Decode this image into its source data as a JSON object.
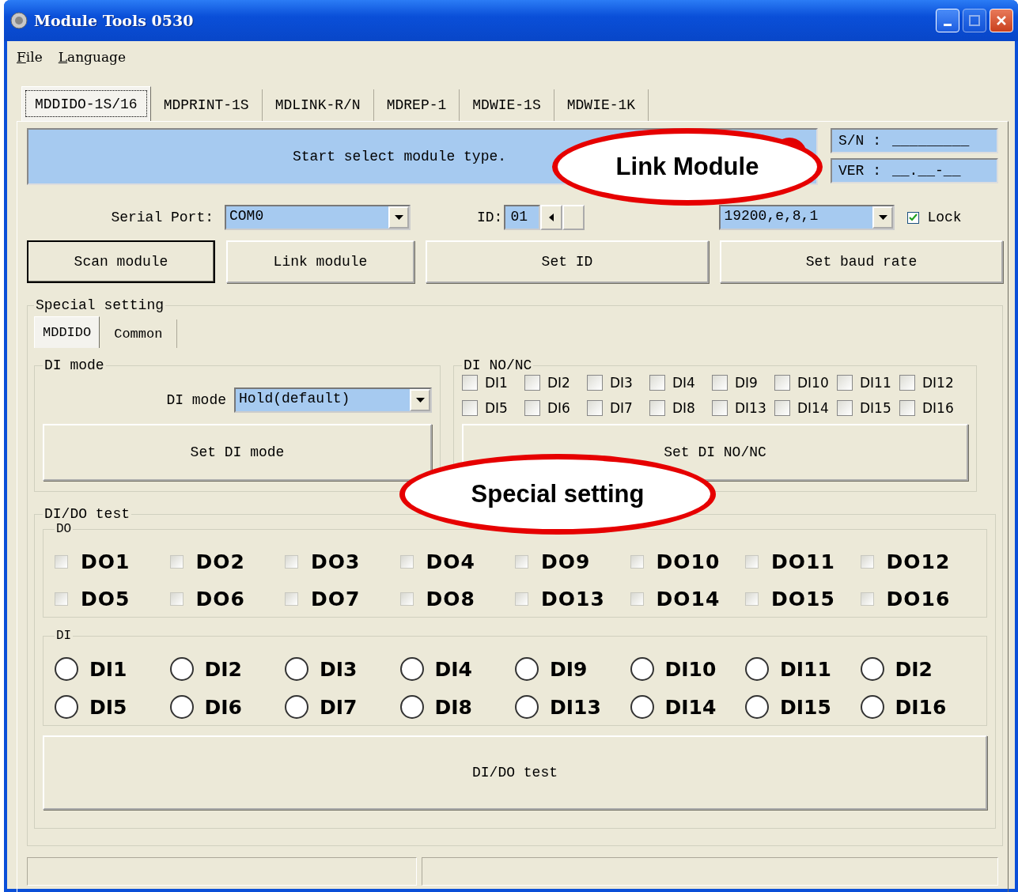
{
  "window": {
    "title": "Module Tools 0530"
  },
  "menu": [
    {
      "label": "File"
    },
    {
      "label": "Language"
    }
  ],
  "tabs": [
    {
      "label": "MDDIDO-1S/16",
      "selected": true
    },
    {
      "label": "MDPRINT-1S",
      "selected": false
    },
    {
      "label": "MDLINK-R/N",
      "selected": false
    },
    {
      "label": "MDREP-1",
      "selected": false
    },
    {
      "label": "MDWIE-1S",
      "selected": false
    },
    {
      "label": "MDWIE-1K",
      "selected": false
    }
  ],
  "status_message": "Start select module type.",
  "info": [
    {
      "label": "S/N :",
      "value": "_________"
    },
    {
      "label": "VER :",
      "value": "__.__-__"
    }
  ],
  "serial_port": {
    "label": "Serial Port:",
    "value": "COM0"
  },
  "id": {
    "label": "ID:",
    "value": "01"
  },
  "baud": {
    "value": "19200,e,8,1"
  },
  "lock": {
    "label": "Lock",
    "checked": true
  },
  "buttons": [
    {
      "label": "Scan module",
      "default": true
    },
    {
      "label": "Link module",
      "default": false
    },
    {
      "label": "Set ID",
      "default": false
    },
    {
      "label": "Set baud rate",
      "default": false
    }
  ],
  "special_setting": {
    "title": "Special setting",
    "tabs": [
      {
        "label": "MDDIDO",
        "selected": true
      },
      {
        "label": "Common",
        "selected": false
      }
    ],
    "di_mode": {
      "title": "DI mode",
      "label": "DI mode",
      "value": "Hold(default)",
      "button": "Set DI mode"
    },
    "di_nonc": {
      "title": "DI NO/NC",
      "items": [
        {
          "label": "DI1",
          "checked": false
        },
        {
          "label": "DI2",
          "checked": false
        },
        {
          "label": "DI3",
          "checked": false
        },
        {
          "label": "DI4",
          "checked": false
        },
        {
          "label": "DI9",
          "checked": false
        },
        {
          "label": "DI10",
          "checked": false
        },
        {
          "label": "DI11",
          "checked": false
        },
        {
          "label": "DI12",
          "checked": false
        },
        {
          "label": "DI5",
          "checked": false
        },
        {
          "label": "DI6",
          "checked": false
        },
        {
          "label": "DI7",
          "checked": false
        },
        {
          "label": "DI8",
          "checked": false
        },
        {
          "label": "DI13",
          "checked": false
        },
        {
          "label": "DI14",
          "checked": false
        },
        {
          "label": "DI15",
          "checked": false
        },
        {
          "label": "DI16",
          "checked": false
        }
      ],
      "button": "Set DI NO/NC"
    },
    "dido_test": {
      "title": "DI/DO test",
      "do": {
        "title": "DO",
        "items": [
          {
            "label": "DO1",
            "checked": false
          },
          {
            "label": "DO2",
            "checked": false
          },
          {
            "label": "DO3",
            "checked": false
          },
          {
            "label": "DO4",
            "checked": false
          },
          {
            "label": "DO9",
            "checked": false
          },
          {
            "label": "DO10",
            "checked": false
          },
          {
            "label": "DO11",
            "checked": false
          },
          {
            "label": "DO12",
            "checked": false
          },
          {
            "label": "DO5",
            "checked": false
          },
          {
            "label": "DO6",
            "checked": false
          },
          {
            "label": "DO7",
            "checked": false
          },
          {
            "label": "DO8",
            "checked": false
          },
          {
            "label": "DO13",
            "checked": false
          },
          {
            "label": "DO14",
            "checked": false
          },
          {
            "label": "DO15",
            "checked": false
          },
          {
            "label": "DO16",
            "checked": false
          }
        ]
      },
      "di": {
        "title": "DI",
        "items": [
          {
            "label": "DI1",
            "selected": false
          },
          {
            "label": "DI2",
            "selected": false
          },
          {
            "label": "DI3",
            "selected": false
          },
          {
            "label": "DI4",
            "selected": false
          },
          {
            "label": "DI9",
            "selected": false
          },
          {
            "label": "DI10",
            "selected": false
          },
          {
            "label": "DI11",
            "selected": false
          },
          {
            "label": "DI2",
            "selected": false
          },
          {
            "label": "DI5",
            "selected": false
          },
          {
            "label": "DI6",
            "selected": false
          },
          {
            "label": "DI7",
            "selected": false
          },
          {
            "label": "DI8",
            "selected": false
          },
          {
            "label": "DI13",
            "selected": false
          },
          {
            "label": "DI14",
            "selected": false
          },
          {
            "label": "DI15",
            "selected": false
          },
          {
            "label": "DI16",
            "selected": false
          }
        ]
      },
      "button": "DI/DO test"
    }
  },
  "callouts": [
    {
      "text": "Link Module"
    },
    {
      "text": "Special setting"
    }
  ]
}
